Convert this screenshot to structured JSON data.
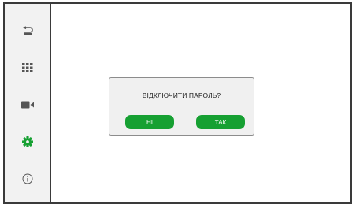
{
  "sidebar": {
    "items": [
      {
        "icon": "back-arrow-icon"
      },
      {
        "icon": "keypad-grid-icon"
      },
      {
        "icon": "video-camera-icon"
      },
      {
        "icon": "gear-icon",
        "color": "#16a032",
        "active": true
      },
      {
        "icon": "info-icon"
      }
    ]
  },
  "dialog": {
    "title": "ВІДКЛЮЧИТИ ПАРОЛЬ?",
    "no_label": "НІ",
    "yes_label": "ТАК"
  },
  "colors": {
    "accent": "#16a032",
    "icon": "#555555",
    "border": "#3a3a3a"
  }
}
